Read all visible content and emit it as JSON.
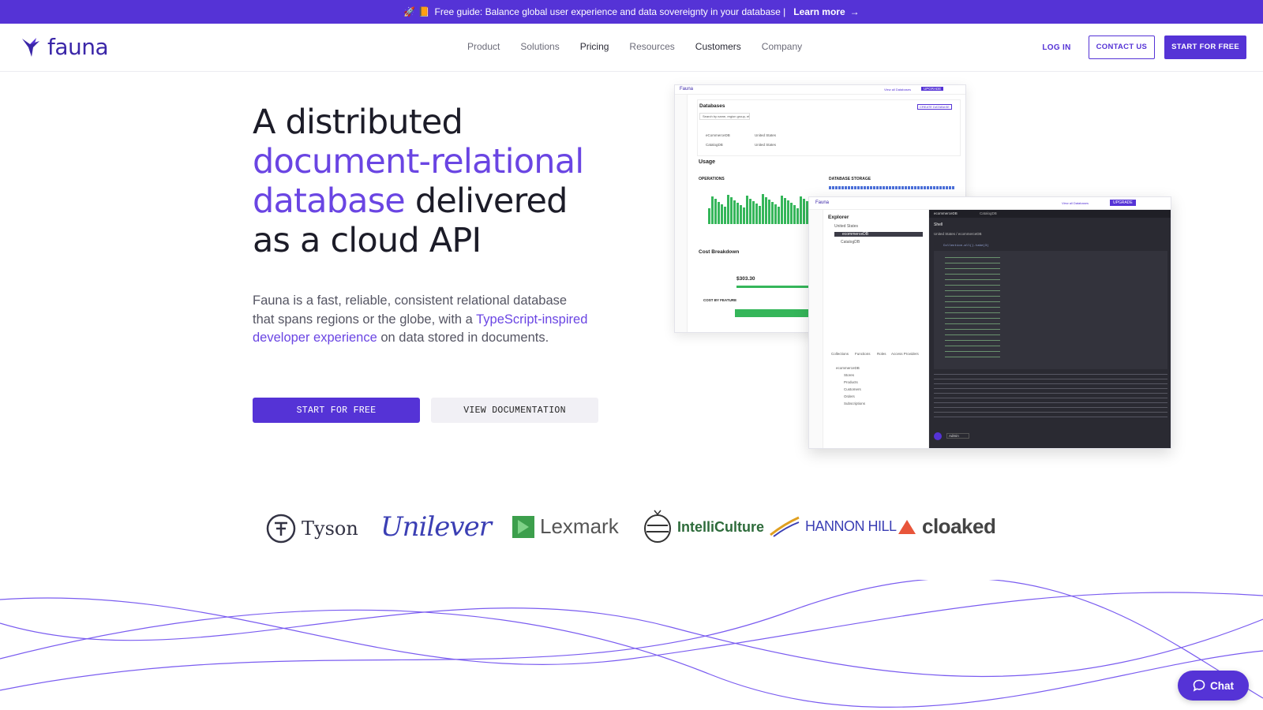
{
  "announcement": {
    "emoji": "🚀 📙",
    "text": "Free guide: Balance global user experience and data sovereignty in your database |",
    "link": "Learn more",
    "arrow": "→"
  },
  "header": {
    "brand": "fauna",
    "nav": [
      "Product",
      "Solutions",
      "Pricing",
      "Resources",
      "Customers",
      "Company"
    ],
    "login": "LOG IN",
    "contact": "CONTACT US",
    "start": "START FOR FREE"
  },
  "hero": {
    "title_1": "A distributed",
    "title_accent_1": "document-relational",
    "title_accent_2": "database",
    "title_2": " delivered",
    "title_3": "as a cloud API",
    "desc_1": "Fauna is a fast, reliable, consistent relational database that spans regions or the globe, with a ",
    "desc_link": "TypeScript-inspired developer experience",
    "desc_2": " on data stored in documents.",
    "cta_primary": "START FOR FREE",
    "cta_secondary": "VIEW DOCUMENTATION"
  },
  "dashboard": {
    "app": "Fauna",
    "databases_title": "Databases",
    "search_placeholder": "Search by name, region group, etc",
    "create_db": "CREATE DATABASE",
    "rows": [
      "eCommerceDB",
      "CatalogDB"
    ],
    "region": "United States",
    "usage": "Usage",
    "operations": "OPERATIONS",
    "db_storage": "DATABASE STORAGE",
    "cost_breakdown": "Cost Breakdown",
    "cost": "$303.30",
    "cost_by_feature": "COST BY FEATURE",
    "upgrade": "UPGRADE",
    "view_all": "View all Databases"
  },
  "explorer": {
    "title": "Explorer",
    "region": "United States",
    "dbs": [
      "ecommerceDB",
      "CatalogDB"
    ],
    "tabs": [
      "ecommerceDB",
      "CatalogDB"
    ],
    "shell": "Shell",
    "breadcrumb": "United States / ecommerceDB",
    "collections_tabs": [
      "Collections",
      "Functions",
      "Roles",
      "Access Providers"
    ],
    "collections": [
      "Stores",
      "Products",
      "Customers",
      "Orders",
      "Subscriptions"
    ],
    "role": "Admin",
    "code": "Collection.all().take(3)"
  },
  "logos": [
    "Tyson",
    "Unilever",
    "Lexmark",
    "IntelliCulture",
    "HANNON HILL",
    "cloaked"
  ],
  "chat": "Chat"
}
